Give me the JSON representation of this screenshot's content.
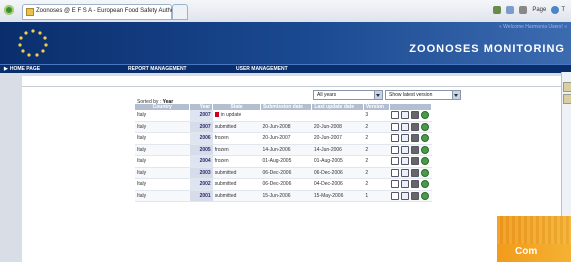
{
  "browser": {
    "tab_title": "Zoonoses @ E F S A - European Food Safety Authority",
    "tools": {
      "page": "Page",
      "tools": "T"
    }
  },
  "site": {
    "tagline": "« Welcome Harmonia Users! »",
    "brand": "ZOONOSES MONITORING"
  },
  "nav": [
    {
      "label": "HOME PAGE"
    },
    {
      "label": "REPORT MANAGEMENT"
    },
    {
      "label": "USER MANAGEMENT"
    }
  ],
  "filters": {
    "years": "All years",
    "version": "Show latest version"
  },
  "sorted": {
    "prefix": "Sorted by :",
    "field": "Year"
  },
  "table": {
    "headers": [
      "Country",
      "Year",
      "State",
      "Submission date",
      "Last update date",
      "Version",
      ""
    ],
    "rows": [
      {
        "country": "Italy",
        "year": "2007",
        "state": "in update",
        "submission": "",
        "last_update": "",
        "version": "3",
        "flag": true
      },
      {
        "country": "Italy",
        "year": "2007",
        "state": "submitted",
        "submission": "20-Jun-2008",
        "last_update": "20-Jun-2008",
        "version": "2",
        "flag": false
      },
      {
        "country": "Italy",
        "year": "2006",
        "state": "frozen",
        "submission": "20-Jun-2007",
        "last_update": "20-Jun-2007",
        "version": "2",
        "flag": false
      },
      {
        "country": "Italy",
        "year": "2005",
        "state": "frozen",
        "submission": "14-Jun-2006",
        "last_update": "14-Jun-2006",
        "version": "2",
        "flag": false
      },
      {
        "country": "Italy",
        "year": "2004",
        "state": "frozen",
        "submission": "01-Aug-2005",
        "last_update": "01-Aug-2005",
        "version": "2",
        "flag": false
      },
      {
        "country": "Italy",
        "year": "2003",
        "state": "submitted",
        "submission": "06-Dec-2006",
        "last_update": "06-Dec-2006",
        "version": "2",
        "flag": false
      },
      {
        "country": "Italy",
        "year": "2002",
        "state": "submitted",
        "submission": "06-Dec-2006",
        "last_update": "04-Dec-2006",
        "version": "2",
        "flag": false
      },
      {
        "country": "Italy",
        "year": "2001",
        "state": "submitted",
        "submission": "15-Jun-2006",
        "last_update": "15-May-2006",
        "version": "1",
        "flag": false
      }
    ]
  },
  "promo": {
    "label": "Com"
  },
  "colors": {
    "header_dark": "#0a2e6c",
    "header_light": "#3c6bb0",
    "table_head": "#b3bed0",
    "promo": "#f29b1b"
  }
}
